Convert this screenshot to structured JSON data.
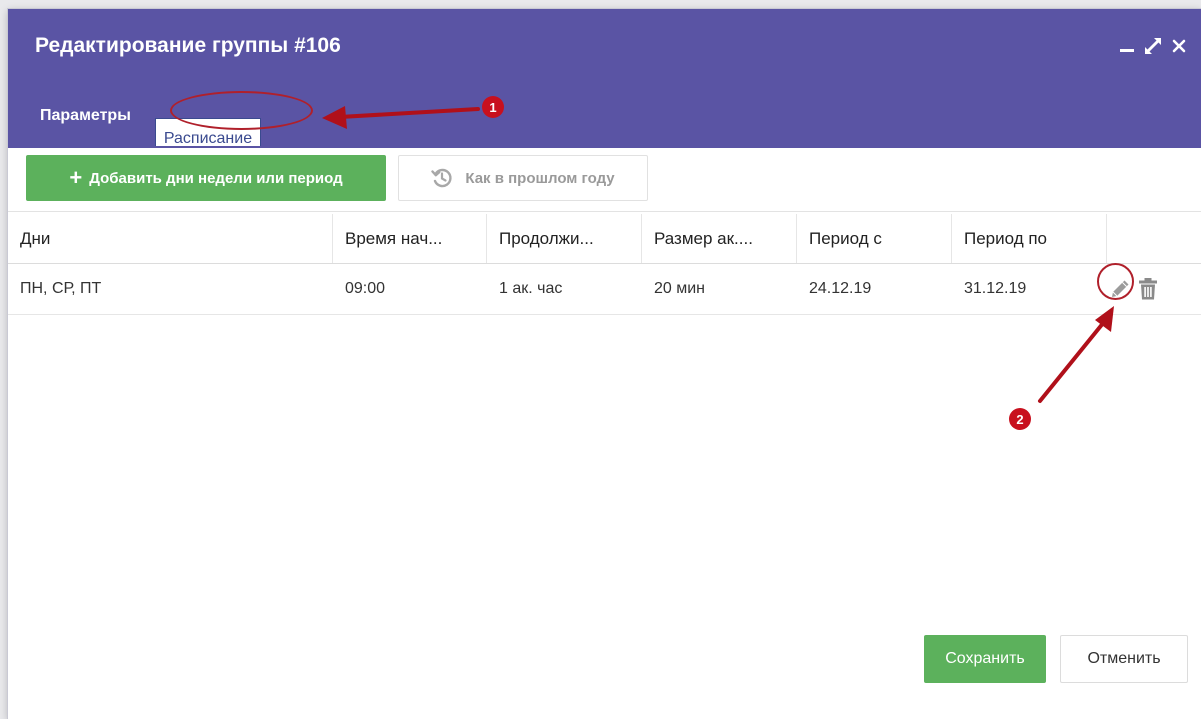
{
  "dialog": {
    "title": "Редактирование группы #106"
  },
  "window_controls": [
    "minimize-icon",
    "maximize-icon",
    "close-icon"
  ],
  "tabs": [
    {
      "label": "Параметры",
      "active": false
    },
    {
      "label": "Расписание",
      "active": true
    }
  ],
  "toolbar": {
    "add_label": "Добавить дни недели или период",
    "last_year_label": "Как в прошлом году"
  },
  "table": {
    "headers": [
      "Дни",
      "Время нач...",
      "Продолжи...",
      "Размер ак....",
      "Период с",
      "Период по"
    ],
    "rows": [
      {
        "days": "ПН, СР, ПТ",
        "start_time": "09:00",
        "duration": "1 ак. час",
        "lesson_size": "20 мин",
        "period_from": "24.12.19",
        "period_to": "31.12.19"
      }
    ],
    "row_action_icons": [
      "pencil-icon",
      "trash-icon"
    ]
  },
  "footer": {
    "save_label": "Сохранить",
    "cancel_label": "Отменить"
  },
  "annotations": {
    "badge_1": "1",
    "badge_2": "2"
  },
  "colors": {
    "header_bg": "#5a54a4",
    "primary_green": "#5cb15c",
    "annotation_red": "#c8101e"
  }
}
